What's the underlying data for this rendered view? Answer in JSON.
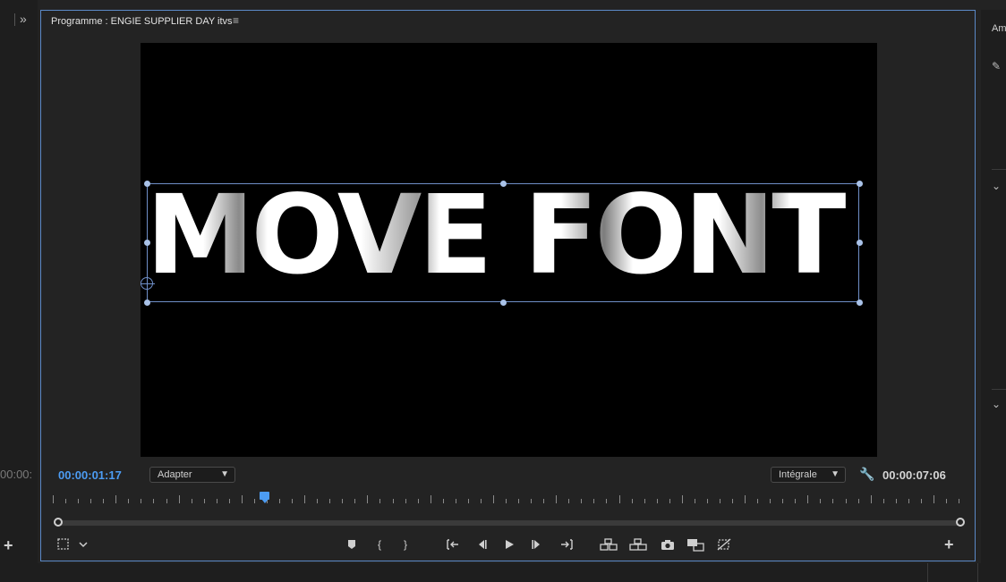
{
  "left_panel": {
    "expand_label": "»",
    "timecode_partial": "00:00:",
    "add_label": "+"
  },
  "panel": {
    "title": "Programme : ENGIE SUPPLIER DAY itvs",
    "menu_label": "≡"
  },
  "video": {
    "title_text": "MOVE FONT"
  },
  "transport": {
    "current_timecode": "00:00:01:17",
    "duration_timecode": "00:00:07:06",
    "zoom_select": {
      "selected": "Adapter"
    },
    "resolution_select": {
      "selected": "Intégrale"
    }
  },
  "playhead_fraction": 0.233,
  "controls": {
    "add_label": "+"
  },
  "right_panel": {
    "label": "Am"
  },
  "colors": {
    "accent": "#4c9cf3",
    "panel_border": "#5b89c7",
    "background": "#232323"
  }
}
